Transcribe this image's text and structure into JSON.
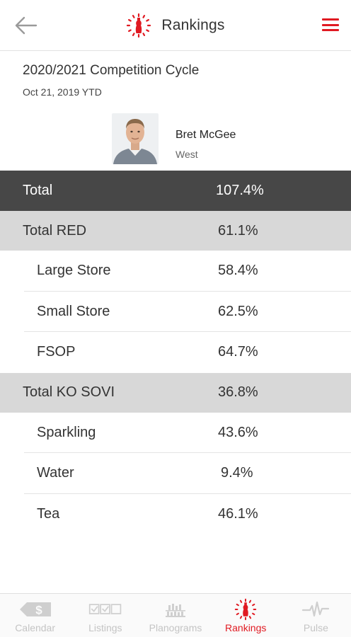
{
  "header": {
    "title": "Rankings",
    "back_icon": "back-arrow-icon",
    "menu_icon": "hamburger-menu-icon",
    "brand_color": "#e01a22"
  },
  "cycle": {
    "title": "2020/2021 Competition Cycle",
    "date": "Oct 21, 2019 YTD"
  },
  "profile": {
    "name": "Bret McGee",
    "region": "West"
  },
  "rankings": {
    "total": {
      "label": "Total",
      "value": "107.4%"
    },
    "red": {
      "label": "Total RED",
      "value": "61.1%",
      "items": [
        {
          "label": "Large Store",
          "value": "58.4%"
        },
        {
          "label": "Small Store",
          "value": "62.5%"
        },
        {
          "label": "FSOP",
          "value": "64.7%"
        }
      ]
    },
    "sovi": {
      "label": "Total KO SOVI",
      "value": "36.8%",
      "items": [
        {
          "label": "Sparkling",
          "value": "43.6%"
        },
        {
          "label": "Water",
          "value": "9.4%"
        },
        {
          "label": "Tea",
          "value": "46.1%"
        }
      ]
    }
  },
  "bottom_nav": {
    "items": [
      {
        "label": "Calendar",
        "icon": "dollar-tag-icon",
        "active": false
      },
      {
        "label": "Listings",
        "icon": "checkboxes-icon",
        "active": false
      },
      {
        "label": "Planograms",
        "icon": "shelf-icon",
        "active": false
      },
      {
        "label": "Rankings",
        "icon": "bottle-logo-icon",
        "active": true
      },
      {
        "label": "Pulse",
        "icon": "pulse-icon",
        "active": false
      }
    ],
    "active_color": "#e01a22",
    "inactive_color": "#c4c4c4"
  }
}
